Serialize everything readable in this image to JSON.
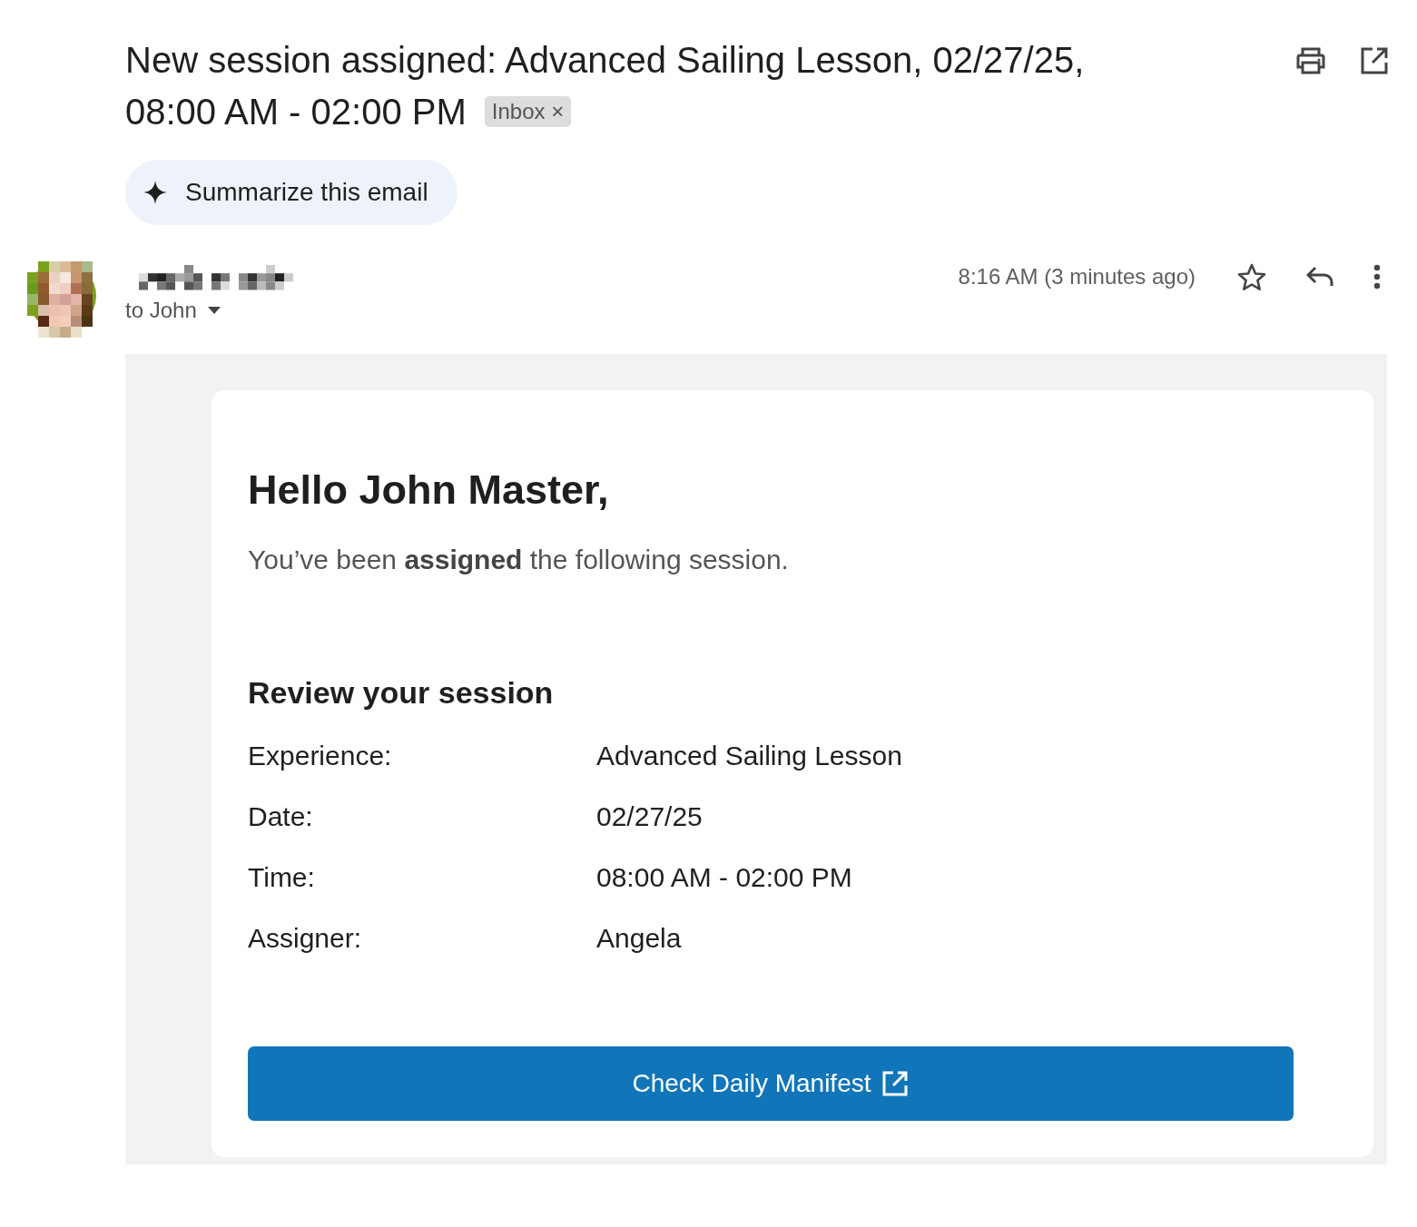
{
  "subject": "New session assigned: Advanced Sailing Lesson, 02/27/25, 08:00 AM - 02:00 PM",
  "label_chip": {
    "text": "Inbox",
    "close": "×"
  },
  "summarize_button": "Summarize this email",
  "recipient": "to John",
  "time": "8:16 AM (3 minutes ago)",
  "starred": false,
  "email_body": {
    "greeting": "Hello John Master,",
    "intro": "You’ve been **assigned** the following session.",
    "section_title": "Review your session",
    "details": [
      {
        "label": "Experience:",
        "value": "Advanced Sailing Lesson"
      },
      {
        "label": "Date:",
        "value": "02/27/25"
      },
      {
        "label": "Time:",
        "value": "08:00 AM - 02:00 PM"
      },
      {
        "label": "Assigner:",
        "value": "Angela"
      }
    ],
    "action_button": "Check Daily Manifest"
  }
}
